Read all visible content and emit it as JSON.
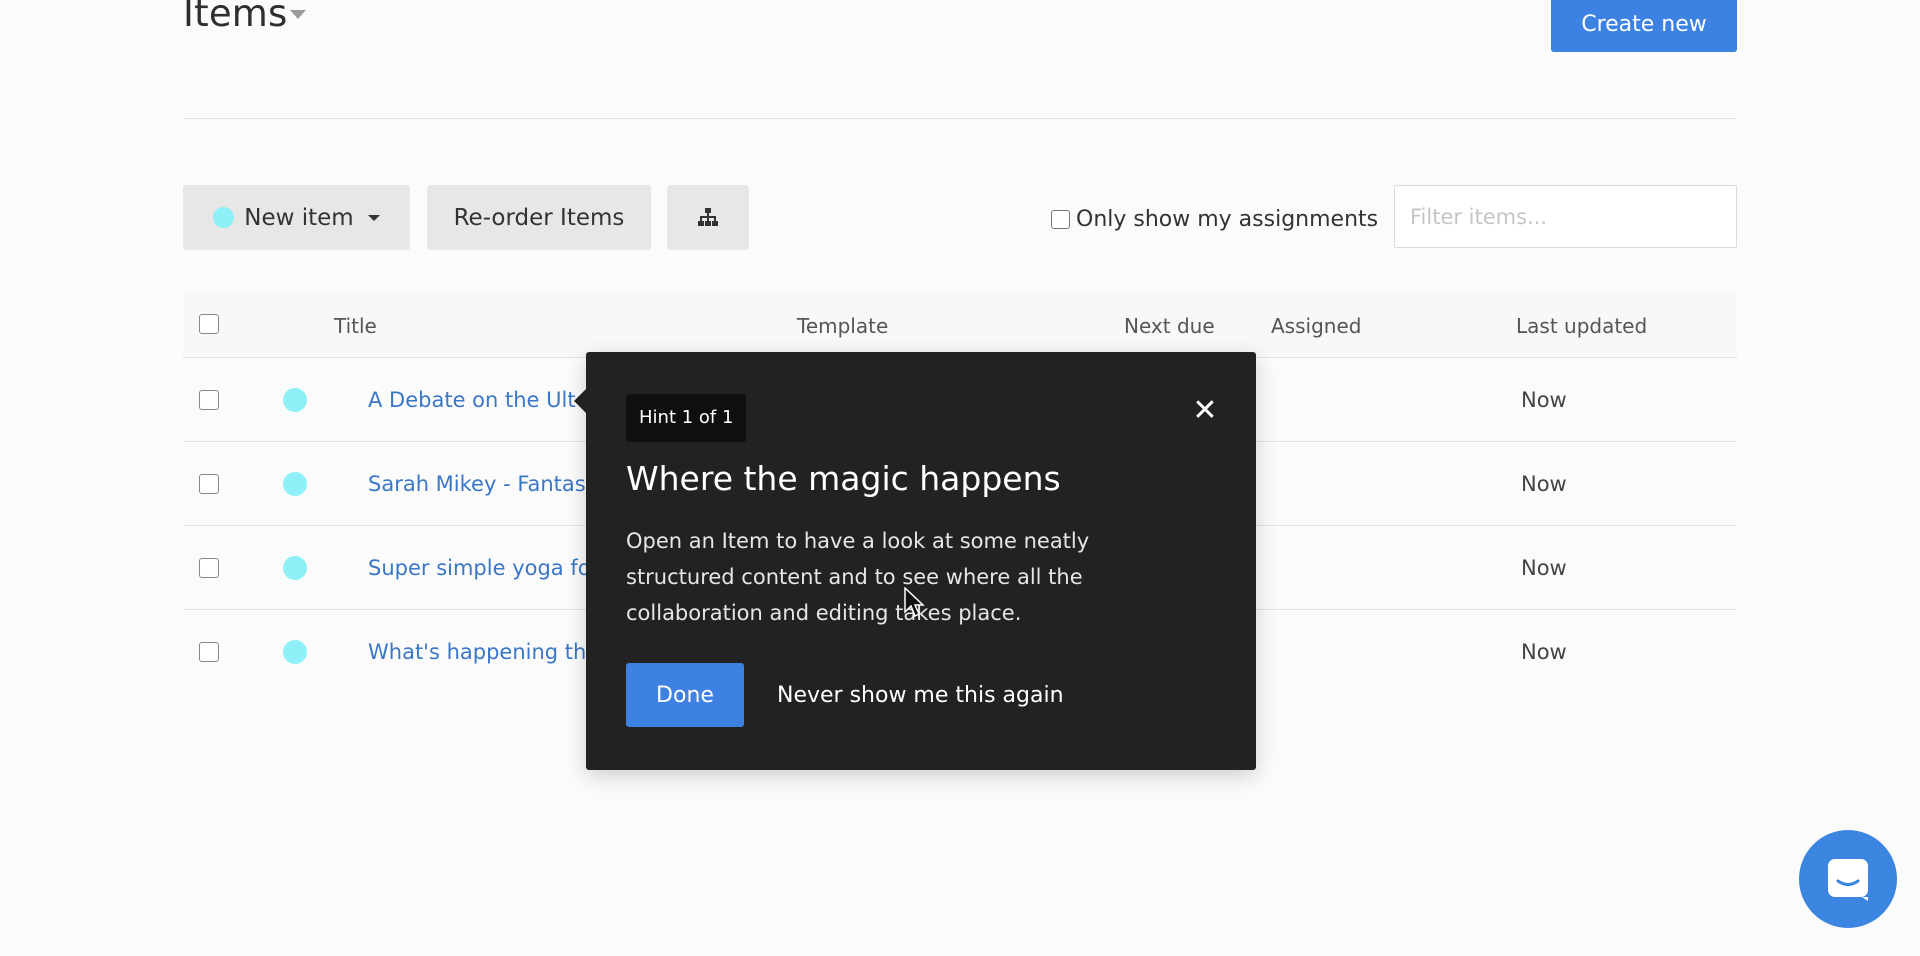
{
  "header": {
    "title": "Items",
    "create_label": "Create new"
  },
  "toolbar": {
    "new_item_label": "New item",
    "reorder_label": "Re-order Items",
    "assignments_label": "Only show my assignments",
    "filter_placeholder": "Filter items..."
  },
  "table": {
    "columns": [
      "Title",
      "Template",
      "Next due",
      "Assigned",
      "Last updated"
    ],
    "rows": [
      {
        "title": "A Debate on the Ult",
        "updated": "Now"
      },
      {
        "title": "Sarah Mikey - Fantast",
        "updated": "Now"
      },
      {
        "title": "Super simple yoga fo",
        "updated": "Now"
      },
      {
        "title": "What's happening th",
        "updated": "Now"
      }
    ]
  },
  "hint": {
    "badge": "Hint 1 of 1",
    "title": "Where the magic happens",
    "body": "Open an Item to have a look at some neatly structured content and to see where all the collaboration and editing takes place.",
    "done_label": "Done",
    "never_label": "Never show me this again",
    "close_glyph": "✕"
  },
  "colors": {
    "accent": "#3d82e3",
    "status_dot": "#8ff0f7",
    "link": "#3a77c6",
    "hint_bg": "#222222"
  },
  "icons": {
    "title_dropdown": "caret-down-icon",
    "tree": "hierarchy-icon",
    "chat": "chat-icon",
    "close": "close-icon"
  }
}
